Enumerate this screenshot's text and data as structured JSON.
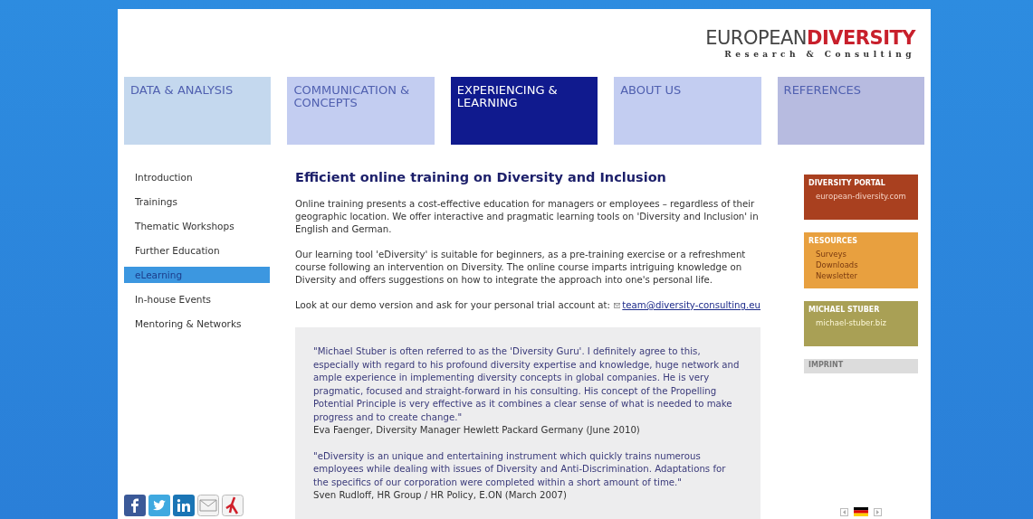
{
  "logo": {
    "word_1": "EUROPEAN",
    "word_2": "DIVERSITY",
    "tagline": "Research & Consulting"
  },
  "nav": [
    {
      "label": "DATA & ANALYSIS",
      "selected": false,
      "color": "#c4d8ee"
    },
    {
      "label": "COMMUNICATION & CONCEPTS",
      "selected": false,
      "color": "#c3cdf1"
    },
    {
      "label": "EXPERIENCING & LEARNING",
      "selected": true,
      "color": "#101a8e"
    },
    {
      "label": "ABOUT US",
      "selected": false,
      "color": "#c3cdf1"
    },
    {
      "label": "REFERENCES",
      "selected": false,
      "color": "#b7bbe0"
    }
  ],
  "sidebar": {
    "items": [
      {
        "label": "Introduction",
        "selected": false
      },
      {
        "label": "Trainings",
        "selected": false
      },
      {
        "label": "Thematic Workshops",
        "selected": false
      },
      {
        "label": "Further Education",
        "selected": false
      },
      {
        "label": "eLearning",
        "selected": true
      },
      {
        "label": "In-house Events",
        "selected": false
      },
      {
        "label": "Mentoring & Networks",
        "selected": false
      }
    ]
  },
  "content": {
    "title": "Efficient online training on Diversity and Inclusion",
    "paragraphs": [
      "Online training presents a cost-effective education for managers or employees – regardless of their geographic location. We offer interactive and pragmatic learning tools on 'Diversity and Inclusion' in English and German.",
      "Our learning tool 'eDiversity' is suitable for beginners, as a pre-training exercise or a refreshment course following an intervention on Diversity. The online course imparts intriguing knowledge on Diversity and offers suggestions on how to integrate the approach into one's personal life."
    ],
    "contact_text": "Look at our demo version and ask for your personal trial account at:",
    "email": "team@diversity-consulting.eu",
    "quotes": [
      {
        "text": "\"Michael Stuber is often referred to as the 'Diversity Guru'. I definitely agree to this, especially with regard to his profound diversity expertise and knowledge, huge network and ample experience in implementing diversity concepts in global companies. He is very pragmatic, focused and straight-forward in his consulting. His concept of the Propelling Potential Principle is very effective as it combines a clear sense of what is needed to make progress and to create change.\"",
        "author": "Eva Faenger, Diversity Manager Hewlett Packard Germany (June 2010)"
      },
      {
        "text": "\"eDiversity is an unique and entertaining instrument which quickly trains numerous employees while dealing with issues of Diversity and Anti-Discrimination. Adaptations for the specifics of our corporation were completed within a short amount of time.\"",
        "author": "Sven Rudloff, HR Group / HR Policy, E.ON (March 2007)"
      }
    ]
  },
  "right_boxes": [
    {
      "title": "DIVERSITY PORTAL",
      "color": "#a9401f",
      "links": [
        "european-diversity.com"
      ]
    },
    {
      "title": "RESOURCES",
      "color": "#e8a03f",
      "links": [
        "Surveys",
        "Downloads",
        "Newsletter"
      ]
    },
    {
      "title": "MICHAEL STUBER",
      "color": "#a9a055",
      "links": [
        "michael-stuber.biz"
      ]
    },
    {
      "title": "IMPRINT",
      "color": "#dcdcdc"
    }
  ]
}
